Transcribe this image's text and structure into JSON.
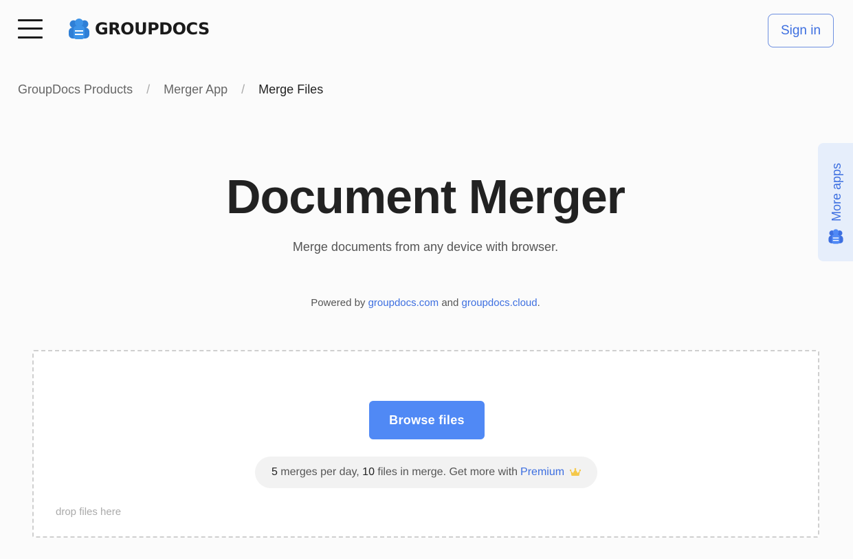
{
  "header": {
    "logo_text": "GROUPDOCS",
    "signin_label": "Sign in"
  },
  "breadcrumb": {
    "items": [
      "GroupDocs Products",
      "Merger App",
      "Merge Files"
    ],
    "separator": "/"
  },
  "hero": {
    "title": "Document Merger",
    "subtitle": "Merge documents from any device with browser.",
    "powered_prefix": "Powered by",
    "powered_link1": "groupdocs.com",
    "powered_and": "and",
    "powered_link2": "groupdocs.cloud",
    "powered_suffix": "."
  },
  "dropzone": {
    "browse_label": "Browse files",
    "merges_count": "5",
    "merges_text": "merges per day,",
    "files_count": "10",
    "files_text": "files in merge. Get more with",
    "premium_label": "Premium",
    "drop_hint": "drop files here"
  },
  "side_tab": {
    "label": "More apps"
  },
  "colors": {
    "accent": "#5089f5",
    "link": "#3d6fe0",
    "crown": "#f5c84a",
    "side_tab_bg": "#e6eefb"
  },
  "icons": {
    "menu": "hamburger-icon",
    "logo": "groupdocs-logo-icon",
    "crown": "crown-icon"
  }
}
